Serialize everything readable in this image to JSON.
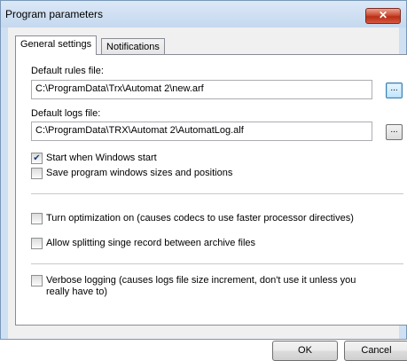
{
  "window": {
    "title": "Program parameters",
    "close_glyph": "✕"
  },
  "tabs": [
    {
      "label": "General settings"
    },
    {
      "label": "Notifications"
    }
  ],
  "rules": {
    "label": "Default rules file:",
    "value": "C:\\ProgramData\\Trx\\Automat 2\\new.arf",
    "browse_label": "..."
  },
  "logs": {
    "label": "Default logs file:",
    "value": "C:\\ProgramData\\TRX\\Automat 2\\AutomatLog.alf",
    "browse_label": "..."
  },
  "options": [
    {
      "label": "Start when Windows start",
      "checked": true
    },
    {
      "label": "Save program windows sizes and positions",
      "checked": false
    },
    {
      "label": "Turn optimization on (causes codecs to use faster processor directives)",
      "checked": false
    },
    {
      "label": "Allow splitting singe record between archive files",
      "checked": false
    },
    {
      "label": "Verbose logging (causes logs file size increment, don't use it unless you really have to)",
      "checked": false
    }
  ],
  "buttons": {
    "ok": "OK",
    "cancel": "Cancel"
  },
  "check_glyph": "✔"
}
